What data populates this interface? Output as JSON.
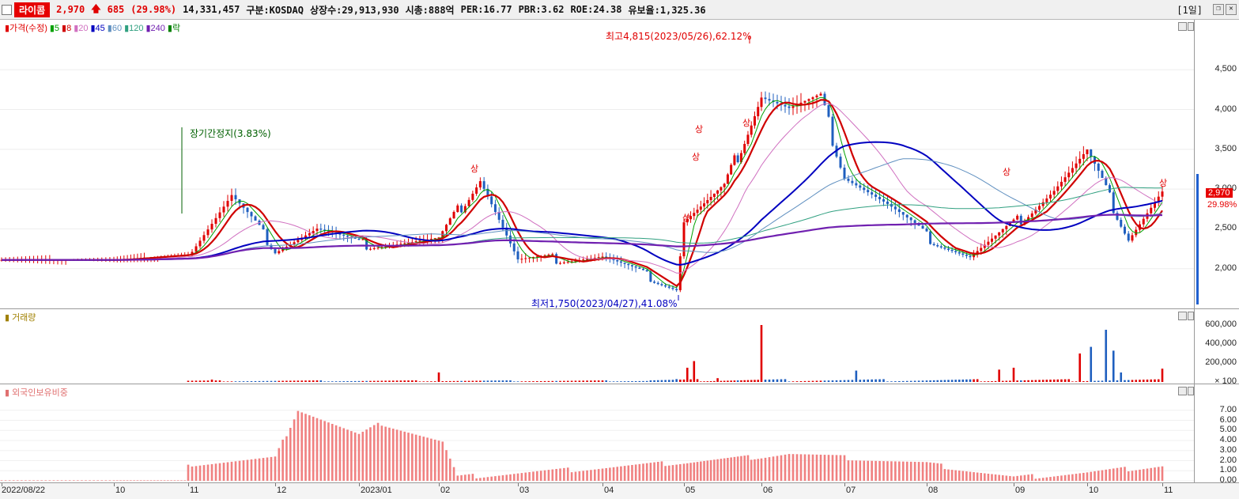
{
  "header": {
    "name": "라이콤",
    "price": "2,970",
    "change": "685",
    "change_pct": "(29.98%)",
    "volume": "14,331,457",
    "market": "구분:KOSDAQ",
    "shares": "상장수:29,913,930",
    "mcap": "시총:888억",
    "per": "PER:16.77",
    "pbr": "PBR:3.62",
    "roe": "ROE:24.38",
    "float": "유보율:1,325.36",
    "period": "[1일]",
    "arrow_icon": "up-arrow-icon",
    "colors": {
      "up": "#e00000",
      "name_bg": "#e60000"
    }
  },
  "price_legend": [
    {
      "label": "가격(수정)",
      "color": "#e00000"
    },
    {
      "label": "5",
      "color": "#00a000"
    },
    {
      "label": "8",
      "color": "#d00000"
    },
    {
      "label": "20",
      "color": "#d070c0"
    },
    {
      "label": "45",
      "color": "#0000c0"
    },
    {
      "label": "60",
      "color": "#6090c0"
    },
    {
      "label": "120",
      "color": "#30a080"
    },
    {
      "label": "240",
      "color": "#7020b0"
    },
    {
      "label": "락",
      "color": "#008000"
    }
  ],
  "volume_legend": {
    "label": "거래량",
    "color": "#a08000"
  },
  "foreign_legend": {
    "label": "외국인보유비중",
    "color": "#e07070"
  },
  "annotations": {
    "high": "최고4,815(2023/05/26),62.12%",
    "low": "최저1,750(2023/04/27),41.08%",
    "halt": "장기간정지(3.83%)",
    "limit_up": "상"
  },
  "current_price_tag": "2,970",
  "current_pct_tag": "29.98%",
  "x_labels": [
    "2022/08/22",
    "10",
    "11",
    "12",
    "2023/01",
    "02",
    "03",
    "04",
    "05",
    "06",
    "07",
    "08",
    "09",
    "10",
    "11"
  ],
  "chart_data": [
    {
      "type": "candlestick",
      "title": "가격(수정)",
      "y_ticks": [
        "4,500",
        "4,000",
        "3,500",
        "3,000",
        "2,500",
        "2,000"
      ],
      "ylim": [
        1550,
        4950
      ],
      "last_close": 2970,
      "high": {
        "value": 4815,
        "date": "2023/05/26"
      },
      "low": {
        "value": 1750,
        "date": "2023/04/27"
      },
      "approx_closes": [
        {
          "x": "2022/08/22",
          "y": 2110
        },
        {
          "x": "2022/10",
          "y": 2110
        },
        {
          "x": "2022/11",
          "y": 2180
        },
        {
          "x": "2022/11 mid",
          "y": 2900
        },
        {
          "x": "2022/12",
          "y": 2250
        },
        {
          "x": "2022/12 mid",
          "y": 2500
        },
        {
          "x": "2023/01",
          "y": 2300
        },
        {
          "x": "2023/02",
          "y": 2350
        },
        {
          "x": "2023/02 mid",
          "y": 3150
        },
        {
          "x": "2023/03",
          "y": 2100
        },
        {
          "x": "2023/04",
          "y": 2150
        },
        {
          "x": "2023/04/27",
          "y": 1750
        },
        {
          "x": "2023/05",
          "y": 2600
        },
        {
          "x": "2023/05 mid",
          "y": 3000
        },
        {
          "x": "2023/05/26",
          "y": 4200
        },
        {
          "x": "2023/06",
          "y": 4000
        },
        {
          "x": "2023/06 mid",
          "y": 4100
        },
        {
          "x": "2023/07",
          "y": 3200
        },
        {
          "x": "2023/07 mid",
          "y": 2800
        },
        {
          "x": "2023/08",
          "y": 2400
        },
        {
          "x": "2023/08 mid",
          "y": 2150
        },
        {
          "x": "2023/09",
          "y": 2550
        },
        {
          "x": "2023/09 mid",
          "y": 3000
        },
        {
          "x": "2023/10",
          "y": 3450
        },
        {
          "x": "2023/10 mid",
          "y": 2400
        },
        {
          "x": "2023/11",
          "y": 2970
        }
      ]
    },
    {
      "type": "bar",
      "title": "거래량",
      "y_ticks": [
        "600,000",
        "400,000",
        "200,000",
        "100"
      ],
      "ylim": [
        0,
        650000
      ]
    },
    {
      "type": "bar",
      "title": "외국인보유비중",
      "y_ticks": [
        "7.00",
        "6.00",
        "5.00",
        "4.00",
        "3.00",
        "2.00",
        "1.00",
        "0.00"
      ],
      "ylim": [
        0,
        8
      ],
      "approx_levels": [
        {
          "x": "2022/08-10",
          "y": 0.05
        },
        {
          "x": "2022/11",
          "y": 1.3
        },
        {
          "x": "2022/12 mid",
          "y": 7.1
        },
        {
          "x": "2023/01",
          "y": 4.5
        },
        {
          "x": "2023/01 mid",
          "y": 5.7
        },
        {
          "x": "2023/02",
          "y": 3.8
        },
        {
          "x": "2023/03",
          "y": 0.35
        },
        {
          "x": "2023/05/26",
          "y": 2.4
        },
        {
          "x": "2023/06",
          "y": 2.7
        },
        {
          "x": "2023/08",
          "y": 1.7
        },
        {
          "x": "2023/09",
          "y": 0.3
        },
        {
          "x": "2023/10",
          "y": 0.8
        },
        {
          "x": "2023/11",
          "y": 1.5
        }
      ]
    }
  ]
}
